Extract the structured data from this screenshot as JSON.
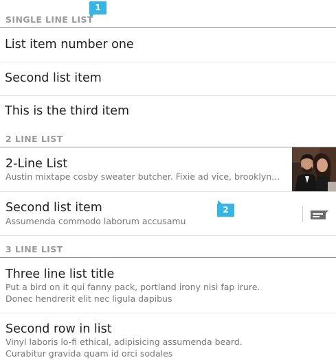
{
  "sections": [
    {
      "header": "SINGLE LINE LIST",
      "items": [
        {
          "title": "List item number one"
        },
        {
          "title": "Second list item"
        },
        {
          "title": "This is the third item"
        }
      ]
    },
    {
      "header": "2 LINE LIST",
      "items": [
        {
          "title": "2-Line List",
          "subtitle": "Austin mixtape cosby sweater butcher. Fixie ad vice, brooklyn..."
        },
        {
          "title": "Second list item",
          "subtitle": "Assumenda commodo laborum accusamu"
        }
      ]
    },
    {
      "header": "3 LINE LIST",
      "items": [
        {
          "title": "Three line list title",
          "line2": "Put a bird on it qui fanny pack, portland irony nisi fap irure.",
          "line3": "Donec hendrerit elit nec ligula dapibus"
        },
        {
          "title": "Second row in list",
          "line2": "Vinyl laboris lo-fi ethical, adipisicing assumenda beard.",
          "line3": "Curabitur gravida quam id orci sodales"
        }
      ]
    }
  ],
  "callouts": [
    "1",
    "2"
  ],
  "icons": {
    "thumbnail": "couple-photo-thumbnail",
    "action": "message-icon"
  },
  "colors": {
    "callout": "#33b5e5",
    "header_text": "#9a9a9a"
  }
}
